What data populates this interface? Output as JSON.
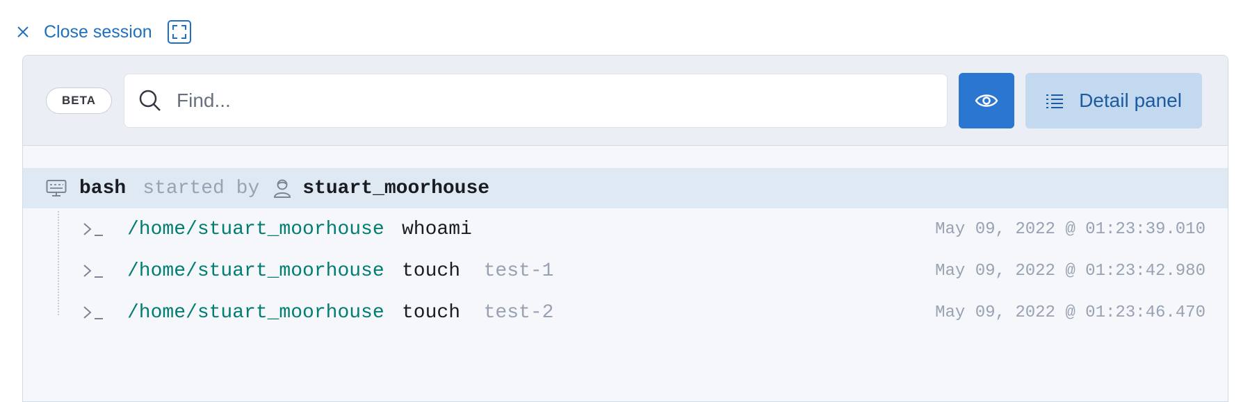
{
  "header": {
    "close_label": "Close session"
  },
  "toolbar": {
    "beta_label": "BETA",
    "search_placeholder": "Find...",
    "detail_panel_label": "Detail panel"
  },
  "session": {
    "command": "bash",
    "started_by_text": "started by",
    "user": "stuart_moorhouse"
  },
  "processes": [
    {
      "path": "/home/stuart_moorhouse",
      "command": "whoami",
      "args": "",
      "timestamp": "May 09, 2022 @ 01:23:39.010"
    },
    {
      "path": "/home/stuart_moorhouse",
      "command": "touch",
      "args": "test-1",
      "timestamp": "May 09, 2022 @ 01:23:42.980"
    },
    {
      "path": "/home/stuart_moorhouse",
      "command": "touch",
      "args": "test-2",
      "timestamp": "May 09, 2022 @ 01:23:46.470"
    }
  ],
  "colors": {
    "primary": "#2b76d0",
    "path_green": "#017d73",
    "muted": "#98a2b3",
    "session_highlight": "#dfe9f3"
  },
  "icons": [
    "close-icon",
    "fullscreen-icon",
    "search-icon",
    "eye-icon",
    "list-icon",
    "terminal-icon",
    "user-icon",
    "prompt-icon"
  ]
}
